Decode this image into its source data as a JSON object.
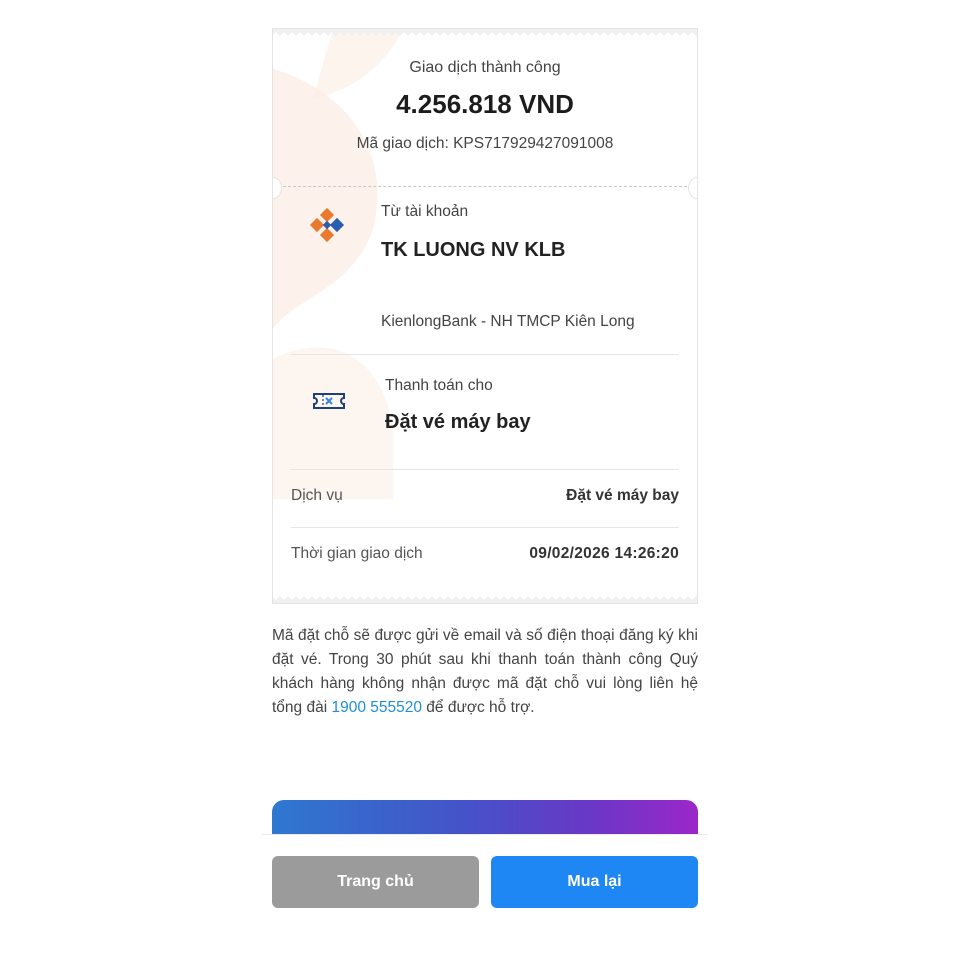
{
  "receipt": {
    "status": "Giao dịch thành công",
    "amount": "4.256.818 VND",
    "transaction_code": "Mã giao dịch: KPS717929427091008",
    "from_account": {
      "label": "Từ tài khoản",
      "name": "TK LUONG NV KLB",
      "bank": "KienlongBank - NH TMCP Kiên Long",
      "icon": "kienlongbank-logo-icon"
    },
    "payment_for": {
      "label": "Thanh toán cho",
      "value": "Đặt vé máy bay",
      "icon": "ticket-icon"
    },
    "details": [
      {
        "label": "Dịch vụ",
        "value": "Đặt vé máy bay"
      },
      {
        "label": "Thời gian giao dịch",
        "value": "09/02/2026 14:26:20"
      }
    ]
  },
  "note": {
    "text_before": "Mã đặt chỗ sẽ được gửi về email và số điện thoại đăng ký khi đặt vé. Trong 30 phút sau khi thanh toán thành công Quý khách hàng không nhận được mã đặt chỗ vui lòng liên hệ tổng đài ",
    "hotline": "1900 555520",
    "text_after": " để được hỗ trợ."
  },
  "buttons": {
    "home": "Trang chủ",
    "buy_again": "Mua lại"
  },
  "colors": {
    "primary": "#1f87f3",
    "secondary_button": "#9b9b9b",
    "hotline": "#1e8fd6",
    "brand_orange": "#e8792e"
  }
}
